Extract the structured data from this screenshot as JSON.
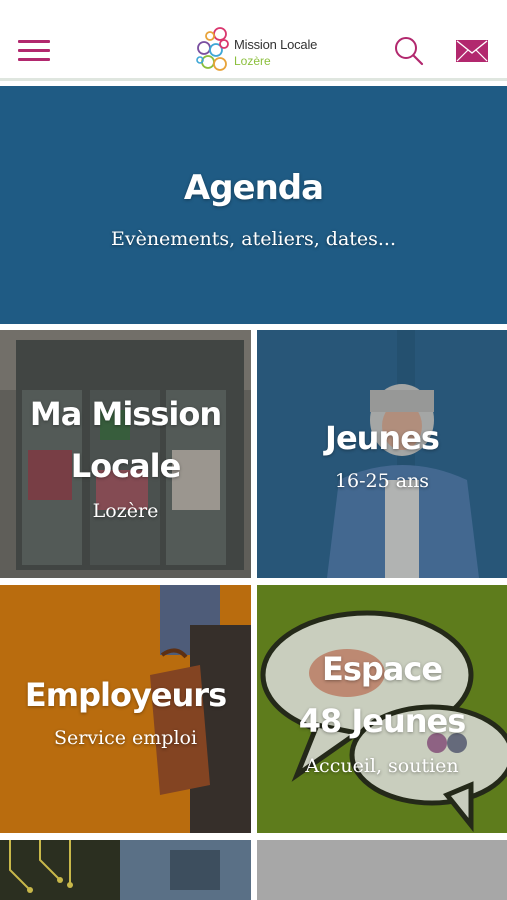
{
  "header": {
    "logo_line1": "Mission Locale",
    "logo_line2": "Lozère",
    "accent_color": "#b2286e"
  },
  "tiles": {
    "agenda": {
      "title": "Agenda",
      "subtitle": "Evènements, ateliers, dates..."
    },
    "mission": {
      "title_line1": "Ma Mission",
      "title_line2": "Locale",
      "subtitle": "Lozère"
    },
    "jeunes": {
      "title": "Jeunes",
      "subtitle": "16-25 ans"
    },
    "employeurs": {
      "title": "Employeurs",
      "subtitle": "Service emploi"
    },
    "espace": {
      "title_line1": "Espace",
      "title_line2": "48 Jeunes",
      "subtitle": "Accueil, soutien"
    }
  },
  "colors": {
    "agenda": "#1f5b84",
    "employeurs": "#b96d0f",
    "espace": "#6b8e1f",
    "logo_green": "#8bbf3c"
  }
}
